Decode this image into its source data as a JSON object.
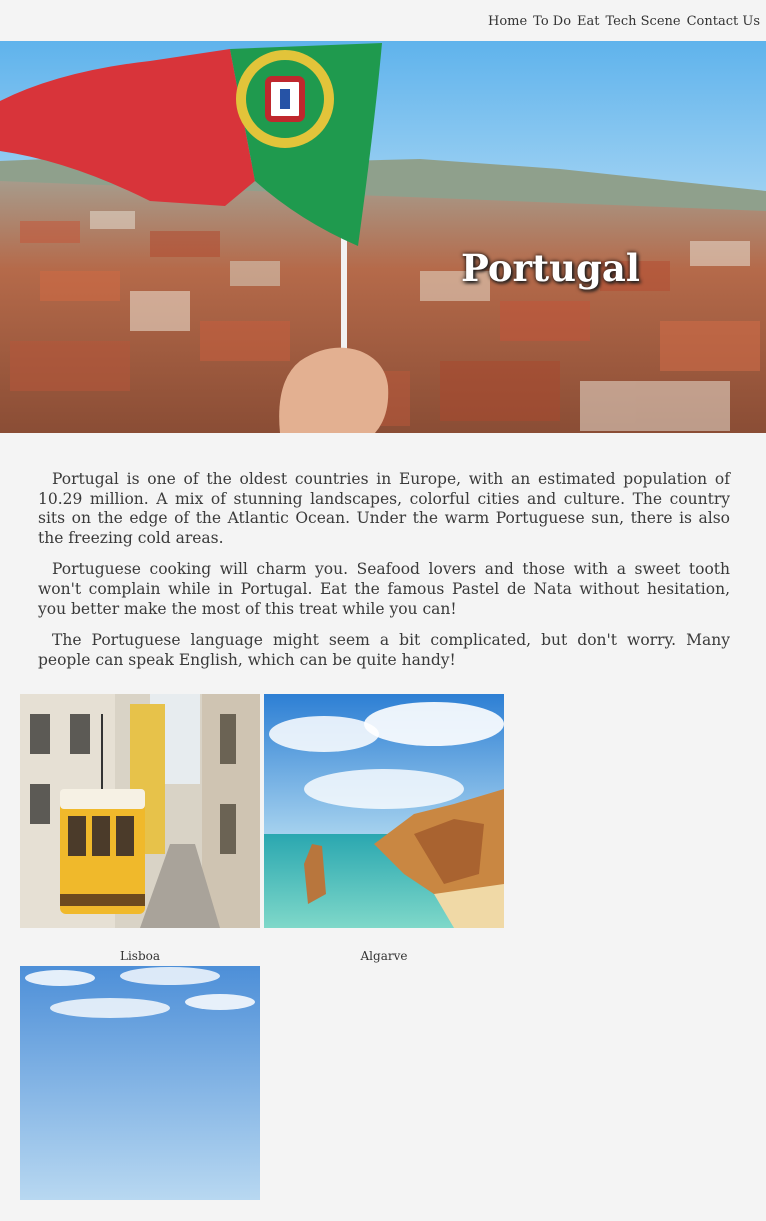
{
  "nav": {
    "items": [
      "Home",
      "To Do",
      "Eat",
      "Tech Scene",
      "Contact Us"
    ]
  },
  "hero": {
    "title": "Portugal"
  },
  "intro": {
    "paragraphs": [
      "Portugal is one of the oldest countries in Europe, with an estimated population of 10.29 million. A mix of stunning landscapes, colorful cities and culture. The country sits on the edge of the Atlantic Ocean. Under the warm Portuguese sun, there is also the freezing cold areas.",
      "Portuguese cooking will charm you. Seafood lovers and those with a sweet tooth won't complain while in Portugal. Eat the famous Pastel de Nata without hesitation, you better make the most of this treat while you can!",
      "The Portuguese language might seem a bit complicated, but don't worry. Many people can speak English, which can be quite handy!"
    ]
  },
  "gallery": [
    {
      "caption": "Lisboa"
    },
    {
      "caption": "Algarve"
    },
    {
      "caption": ""
    }
  ],
  "colors": {
    "background": "#f4f4f4",
    "text": "#333333",
    "flag_red": "#d8343a",
    "flag_green": "#1f9a4e"
  }
}
